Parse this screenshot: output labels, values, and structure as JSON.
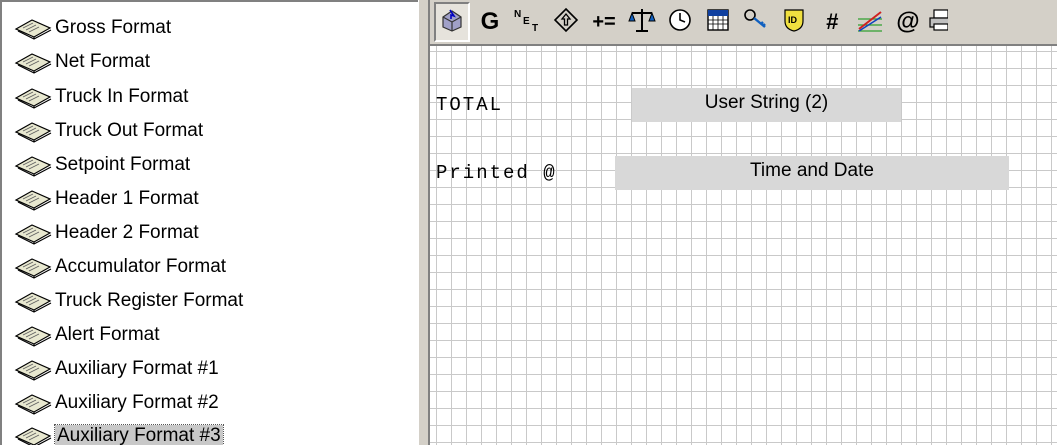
{
  "tree": {
    "items": [
      {
        "label": "Gross Format",
        "selected": false
      },
      {
        "label": "Net Format",
        "selected": false
      },
      {
        "label": "Truck In Format",
        "selected": false
      },
      {
        "label": "Truck Out Format",
        "selected": false
      },
      {
        "label": "Setpoint Format",
        "selected": false
      },
      {
        "label": "Header 1 Format",
        "selected": false
      },
      {
        "label": "Header 2 Format",
        "selected": false
      },
      {
        "label": "Accumulator Format",
        "selected": false
      },
      {
        "label": "Truck Register Format",
        "selected": false
      },
      {
        "label": "Alert Format",
        "selected": false
      },
      {
        "label": "Auxiliary Format #1",
        "selected": false
      },
      {
        "label": "Auxiliary Format #2",
        "selected": false
      },
      {
        "label": "Auxiliary Format #3",
        "selected": true
      }
    ]
  },
  "toolbar": {
    "buttons": [
      {
        "icon": "pointer-icon"
      },
      {
        "icon": "gross-icon",
        "text": "G"
      },
      {
        "icon": "net-tare-icon"
      },
      {
        "icon": "setpoint-diamond-icon"
      },
      {
        "icon": "accumulate-icon",
        "text": "+="
      },
      {
        "icon": "scale-icon"
      },
      {
        "icon": "clock-icon"
      },
      {
        "icon": "calendar-icon"
      },
      {
        "icon": "key-icon"
      },
      {
        "icon": "id-badge-icon"
      },
      {
        "icon": "number-icon",
        "text": "#"
      },
      {
        "icon": "graph-icon"
      },
      {
        "icon": "at-icon",
        "text": "@"
      },
      {
        "icon": "printer-icon"
      }
    ]
  },
  "canvas": {
    "labels": {
      "total": "TOTAL",
      "printed": "Printed @"
    },
    "fields": {
      "user_string": "User String (2)",
      "time_date": "Time and Date"
    }
  }
}
